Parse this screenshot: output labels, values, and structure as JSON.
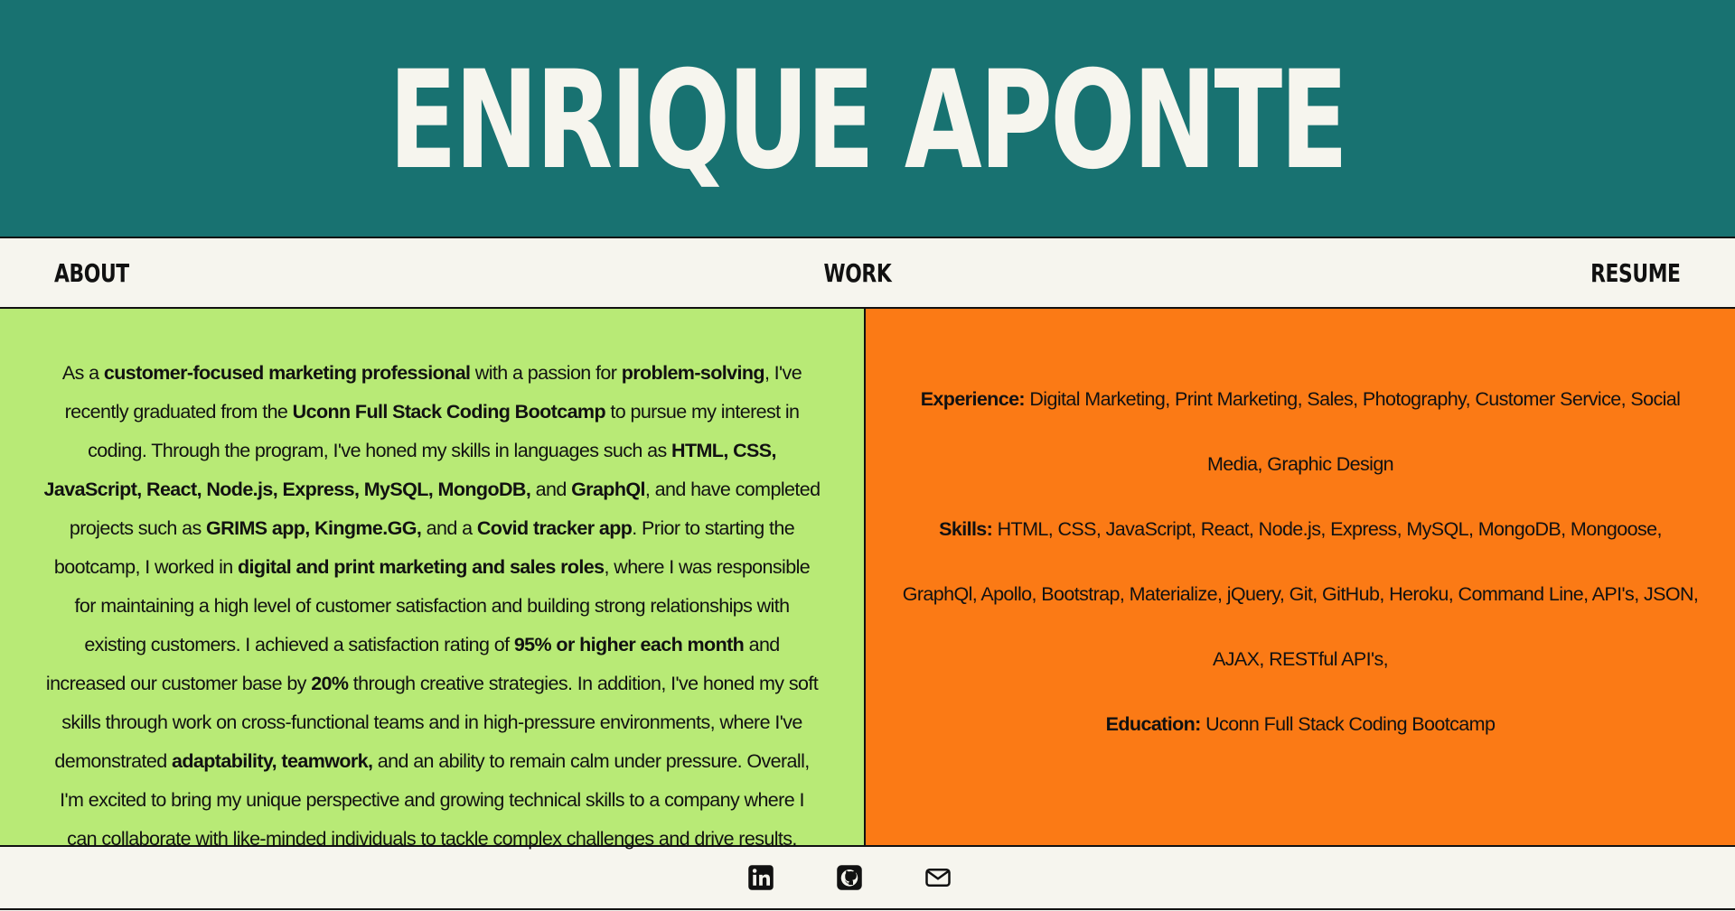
{
  "header": {
    "title": "ENRIQUE APONTE"
  },
  "nav": {
    "about": "ABOUT",
    "work": "WORK",
    "resume": "RESUME"
  },
  "about": {
    "segments": [
      {
        "t": "As a "
      },
      {
        "b": "customer-focused marketing professional"
      },
      {
        "t": " with a passion for "
      },
      {
        "b": "problem-solving"
      },
      {
        "t": ", I've recently graduated from the "
      },
      {
        "b": "Uconn Full Stack Coding Bootcamp"
      },
      {
        "t": " to pursue my interest in coding. Through the program, I've honed my skills in languages such as "
      },
      {
        "b": "HTML, CSS, JavaScript, React, Node.js, Express, MySQL, MongoDB,"
      },
      {
        "t": " and "
      },
      {
        "b": "GraphQl"
      },
      {
        "t": ", and have completed projects such as "
      },
      {
        "b": "GRIMS app, Kingme.GG,"
      },
      {
        "t": " and a "
      },
      {
        "b": "Covid tracker app"
      },
      {
        "t": ". Prior to starting the bootcamp, I worked in "
      },
      {
        "b": "digital and print marketing and sales roles"
      },
      {
        "t": ", where I was responsible for maintaining a high level of customer satisfaction and building strong relationships with existing customers. I achieved a satisfaction rating of "
      },
      {
        "b": "95% or higher each month"
      },
      {
        "t": " and increased our customer base by "
      },
      {
        "b": "20%"
      },
      {
        "t": " through creative strategies. In addition, I've honed my soft skills through work on cross-functional teams and in high-pressure environments, where I've demonstrated "
      },
      {
        "b": "adaptability, teamwork,"
      },
      {
        "t": " and an ability to remain calm under pressure. Overall, I'm excited to bring my unique perspective and growing technical skills to a company where I can collaborate with like-minded individuals to tackle complex challenges and drive results."
      }
    ]
  },
  "resume": {
    "experience_label": "Experience:",
    "experience_value": " Digital Marketing, Print Marketing, Sales, Photography, Customer Service, Social Media, Graphic Design",
    "skills_label": "Skills:",
    "skills_value": " HTML, CSS, JavaScript, React, Node.js, Express, MySQL, MongoDB, Mongoose, GraphQl, Apollo, Bootstrap, Materialize, jQuery, Git, GitHub, Heroku, Command Line, API's, JSON, AJAX, RESTful API's,",
    "education_label": "Education:",
    "education_value": " Uconn Full Stack Coding Bootcamp"
  },
  "footer": {
    "icons": [
      "linkedin-icon",
      "github-icon",
      "email-icon"
    ]
  },
  "colors": {
    "header_bg": "#187271",
    "about_bg": "#b8ea76",
    "resume_bg": "#fb7a15",
    "page_bg": "#f6f5ee"
  }
}
